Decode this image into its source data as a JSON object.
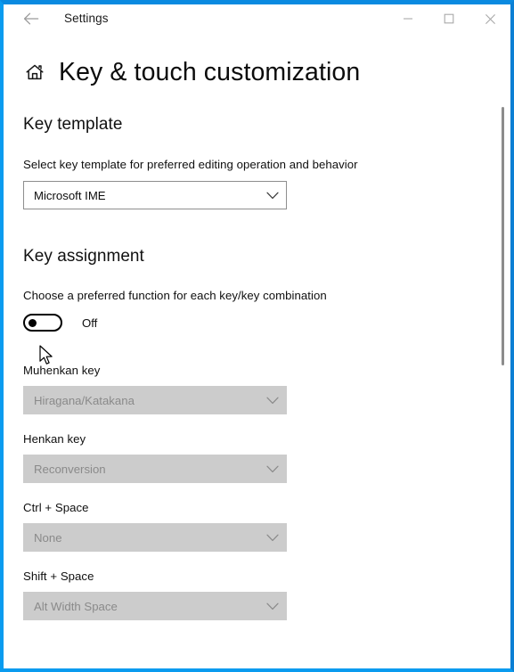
{
  "window": {
    "title": "Settings",
    "back_icon": "back-arrow-icon",
    "minimize_label": "—",
    "maximize_label": "□",
    "close_label": "✕",
    "border_color": "#0a9bef"
  },
  "page": {
    "home_icon": "home-icon",
    "title": "Key & touch customization"
  },
  "key_template": {
    "section_title": "Key template",
    "description": "Select key template for preferred editing operation and behavior",
    "dropdown_value": "Microsoft IME"
  },
  "key_assignment": {
    "section_title": "Key assignment",
    "description": "Choose a preferred function for each key/key combination",
    "toggle_state": "Off",
    "toggle_label": "Off",
    "rows": [
      {
        "label": "Muhenkan key",
        "value": "Hiragana/Katakana",
        "enabled": false
      },
      {
        "label": "Henkan key",
        "value": "Reconversion",
        "enabled": false
      },
      {
        "label": "Ctrl + Space",
        "value": "None",
        "enabled": false
      },
      {
        "label": "Shift + Space",
        "value": "Alt Width Space",
        "enabled": false
      }
    ]
  },
  "scrollbar": {
    "thumb_name": "scrollbar-thumb"
  },
  "cursor": {
    "name": "mouse-cursor"
  }
}
